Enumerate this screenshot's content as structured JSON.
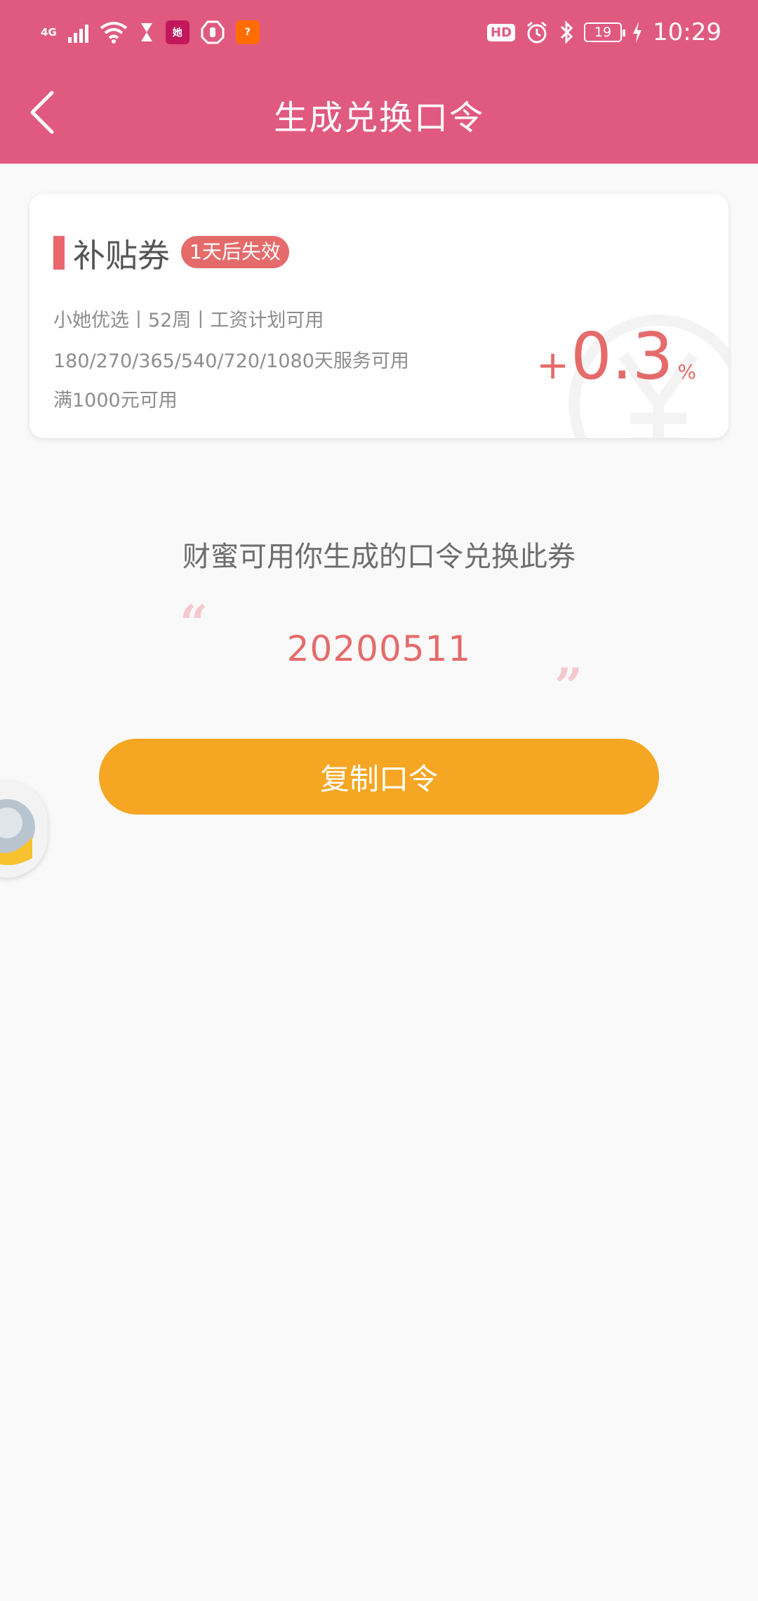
{
  "status_bar": {
    "network": "4G",
    "hd_label": "HD",
    "battery_level": "19",
    "time": "10:29"
  },
  "header": {
    "title": "生成兑换口令",
    "back_icon": "chevron-left-icon"
  },
  "coupon": {
    "name": "补贴券",
    "expiry_badge": "1天后失效",
    "line1": "小她优选丨52周丨工资计划可用",
    "line2": "180/270/365/540/720/1080天服务可用",
    "line3": "满1000元可用",
    "value_sign": "+",
    "value": "0.3",
    "value_unit": "%"
  },
  "redeem": {
    "prompt": "财蜜可用你生成的口令兑换此券",
    "open_quote": "“",
    "close_quote": "”",
    "code": "20200511",
    "copy_button_label": "复制口令"
  },
  "colors": {
    "header_bg": "#e05a80",
    "accent_red": "#e56b6b",
    "button_orange": "#f5a623",
    "page_bg": "#f9f9f9"
  }
}
